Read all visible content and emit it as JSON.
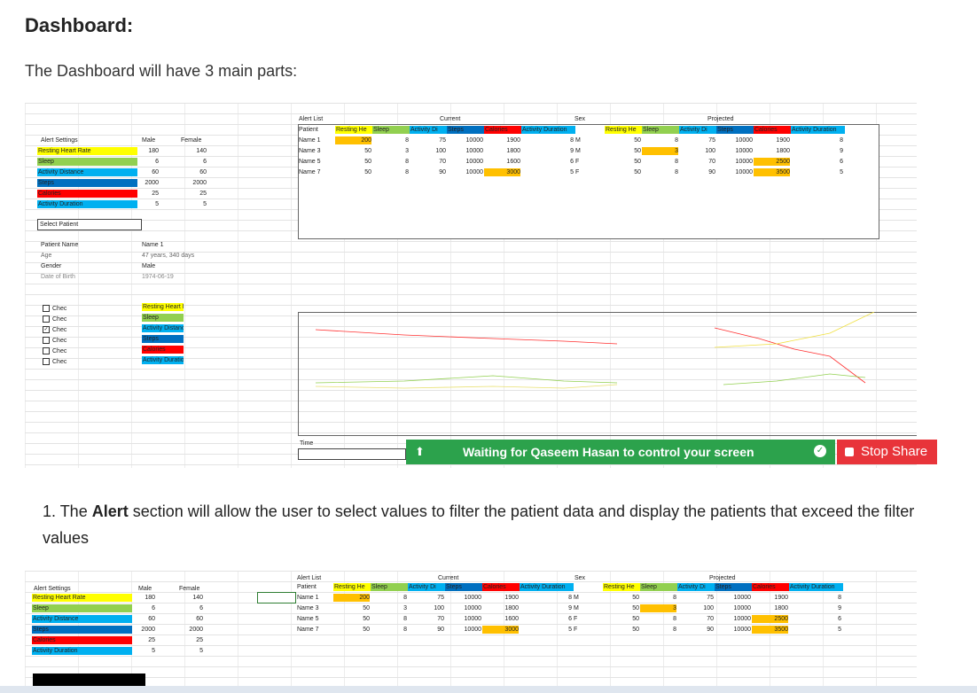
{
  "heading": "Dashboard:",
  "intro": "The Dashboard will have 3 main parts:",
  "alert_settings": {
    "title": "Alert Settings",
    "male": "Male",
    "female": "Female",
    "rows": [
      {
        "label": "Resting Heart Rate",
        "male": "180",
        "female": "140",
        "color": "#ffff00"
      },
      {
        "label": "Sleep",
        "male": "6",
        "female": "6",
        "color": "#92d050"
      },
      {
        "label": "Activity Distance",
        "male": "60",
        "female": "60",
        "color": "#00b0f0"
      },
      {
        "label": "Steps",
        "male": "2000",
        "female": "2000",
        "color": "#0070c0"
      },
      {
        "label": "Calories",
        "male": "25",
        "female": "25",
        "color": "#ff0000"
      },
      {
        "label": "Activity Duration",
        "male": "5",
        "female": "5",
        "color": "#00b0f0"
      }
    ]
  },
  "alert_list": {
    "title": "Alert List",
    "current": "Current",
    "sex": "Sex",
    "projected": "Projected",
    "patient_col": "Patient",
    "headers": [
      "Resting He",
      "Sleep",
      "Activity Di",
      "Steps",
      "Calories",
      "Activity Duration"
    ],
    "rows": [
      {
        "name": "Name 1",
        "cur": [
          "200",
          "8",
          "75",
          "10000",
          "1900",
          "8"
        ],
        "sex": "M",
        "proj": [
          "50",
          "8",
          "75",
          "10000",
          "1900",
          "8"
        ]
      },
      {
        "name": "Name 3",
        "cur": [
          "50",
          "3",
          "100",
          "10000",
          "1800",
          "9"
        ],
        "sex": "M",
        "proj": [
          "50",
          "3",
          "100",
          "10000",
          "1800",
          "9"
        ]
      },
      {
        "name": "Name 5",
        "cur": [
          "50",
          "8",
          "70",
          "10000",
          "1600",
          "6"
        ],
        "sex": "F",
        "proj": [
          "50",
          "8",
          "70",
          "10000",
          "2500",
          "6"
        ]
      },
      {
        "name": "Name 7",
        "cur": [
          "50",
          "8",
          "90",
          "10000",
          "3000",
          "5"
        ],
        "sex": "F",
        "proj": [
          "50",
          "8",
          "90",
          "10000",
          "3500",
          "5"
        ]
      }
    ]
  },
  "select_patient": "Select Patient",
  "patient": {
    "name_label": "Patient Name",
    "name_value": "Name 1",
    "age_label": "Age",
    "age_value": "47 years, 340 days",
    "gender_label": "Gender",
    "gender_value": "Male",
    "dob_label": "Date of Birth",
    "dob_value": "1974-06-19"
  },
  "checkboxes": [
    {
      "label": "Chec",
      "checked": false
    },
    {
      "label": "Chec",
      "checked": false
    },
    {
      "label": "Chec",
      "checked": true
    },
    {
      "label": "Chec",
      "checked": false
    },
    {
      "label": "Chec",
      "checked": false
    },
    {
      "label": "Chec",
      "checked": false
    }
  ],
  "legend": [
    {
      "label": "Resting Heart Rate",
      "color": "#ffff00"
    },
    {
      "label": "Sleep",
      "color": "#92d050"
    },
    {
      "label": "Activity Distance",
      "color": "#00b0f0"
    },
    {
      "label": "Steps",
      "color": "#0070c0"
    },
    {
      "label": "Calories",
      "color": "#ff0000"
    },
    {
      "label": "Activity Duration",
      "color": "#00b0f0"
    }
  ],
  "time_label": "Time",
  "share_bar": {
    "text": "Waiting for Qaseem Hasan to control your screen",
    "stop_label": "Stop Share",
    "bar_color": "#2ca24c",
    "stop_color": "#e8343a"
  },
  "list_item": {
    "number": "1. The ",
    "bold": "Alert",
    "rest": " section will allow the user to select values to filter the patient data and display the patients that exceed the filter values"
  }
}
